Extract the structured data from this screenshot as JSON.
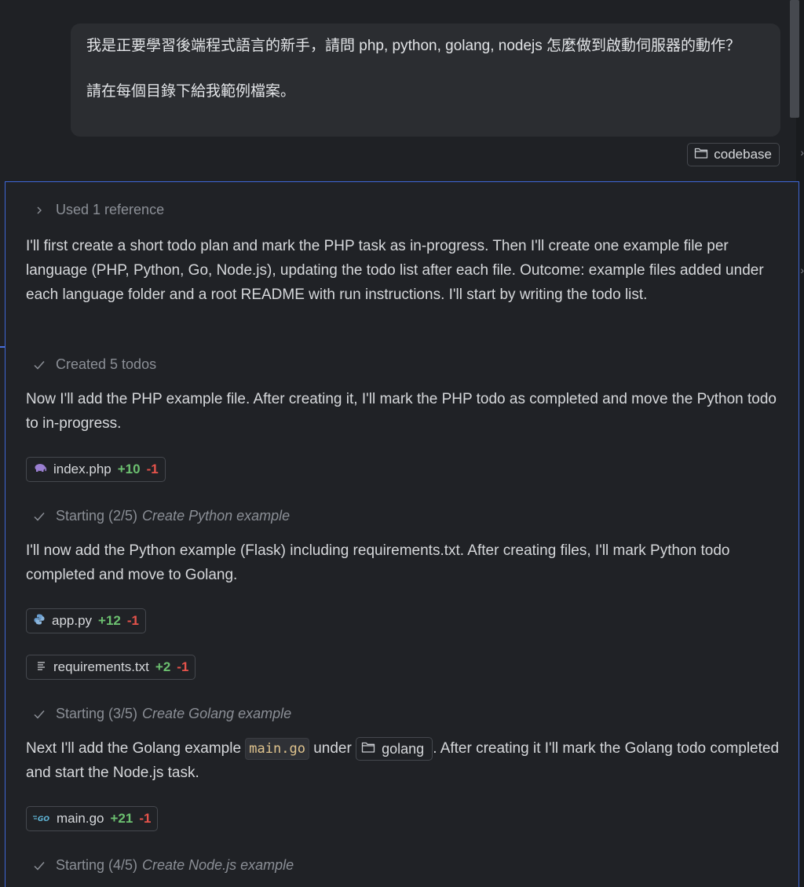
{
  "user_message": {
    "line1": "我是正要學習後端程式語言的新手，請問 php, python, golang, nodejs 怎麼做到啟動伺服器的動作？",
    "line2": "請在每個目錄下給我範例檔案。"
  },
  "reference_chip": {
    "label": "codebase",
    "icon": "folder-icon"
  },
  "response": {
    "used_reference": "Used 1 reference",
    "intro": "I'll first create a short todo plan and mark the PHP task as in-progress. Then I'll create one example file per language (PHP, Python, Go, Node.js), updating the todo list after each file. Outcome: example files added under each language folder and a root README with run instructions. I'll start by writing the todo list.",
    "created_todos": "Created 5 todos",
    "php_para": "Now I'll add the PHP example file. After creating it, I'll mark the PHP todo as completed and move the Python todo to in-progress.",
    "php_file": {
      "name": "index.php",
      "added": "+10",
      "removed": "-1"
    },
    "step2_prefix": "Starting (2/5)",
    "step2_task": "Create Python example",
    "python_para": "I'll now add the Python example (Flask) including requirements.txt. After creating files, I'll mark Python todo completed and move to Golang.",
    "py_file": {
      "name": "app.py",
      "added": "+12",
      "removed": "-1"
    },
    "req_file": {
      "name": "requirements.txt",
      "added": "+2",
      "removed": "-1"
    },
    "step3_prefix": "Starting (3/5)",
    "step3_task": "Create Golang example",
    "go_para_a": "Next I'll add the Golang example",
    "go_code": "main.go",
    "go_para_b": "under",
    "go_folder": "golang",
    "go_para_c": ". After creating it I'll mark the Golang todo completed and start the Node.js task.",
    "go_file": {
      "name": "main.go",
      "added": "+21",
      "removed": "-1"
    },
    "step4_prefix": "Starting (4/5)",
    "step4_task": "Create Node.js example"
  },
  "colors": {
    "accent_border": "#3e67d6",
    "diff_added": "#6cc070",
    "diff_removed": "#e5534b"
  }
}
